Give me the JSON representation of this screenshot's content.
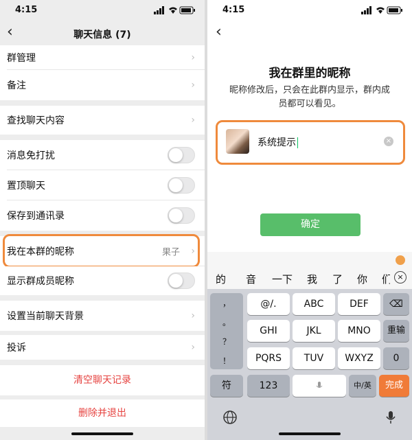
{
  "left": {
    "status": {
      "time": "4:15"
    },
    "nav": {
      "title": "聊天信息 (7)"
    },
    "rows": {
      "group_manage": "群管理",
      "remark": "备注",
      "search_chat": "查找聊天内容",
      "mute": "消息免打扰",
      "pin": "置顶聊天",
      "save_contacts": "保存到通讯录",
      "my_nickname": "我在本群的昵称",
      "my_nickname_value": "果子",
      "show_member_nicknames": "显示群成员昵称",
      "set_background": "设置当前聊天背景",
      "complain": "投诉"
    },
    "toggles": {
      "mute": false,
      "pin": false,
      "save_contacts": false,
      "show_member_nicknames": false
    },
    "actions": {
      "clear_history": "清空聊天记录",
      "delete_exit": "删除并退出"
    }
  },
  "right": {
    "status": {
      "time": "4:15"
    },
    "title": "我在群里的昵称",
    "description": "昵称修改后，只会在此群内显示，群内成员都可以看见。",
    "nickname_value": "系统提示",
    "confirm_label": "确定",
    "candidates": [
      "的",
      "音",
      "一下",
      "我",
      "了",
      "你",
      "们"
    ],
    "keyboard": {
      "punct": [
        "，",
        "。",
        "？",
        "！"
      ],
      "row1": [
        "@/.",
        "ABC",
        "DEF"
      ],
      "row2": [
        "GHI",
        "JKL",
        "MNO"
      ],
      "row3": [
        "PQRS",
        "TUV",
        "WXYZ"
      ],
      "backspace": "⌫",
      "reenter": "重输",
      "zero": "0",
      "symbol": "符",
      "num": "123",
      "lang": "中/英",
      "done": "完成"
    }
  },
  "colors": {
    "accent_orange": "#ef8a3c",
    "confirm_green": "#58be6a",
    "danger_red": "#e64340"
  }
}
